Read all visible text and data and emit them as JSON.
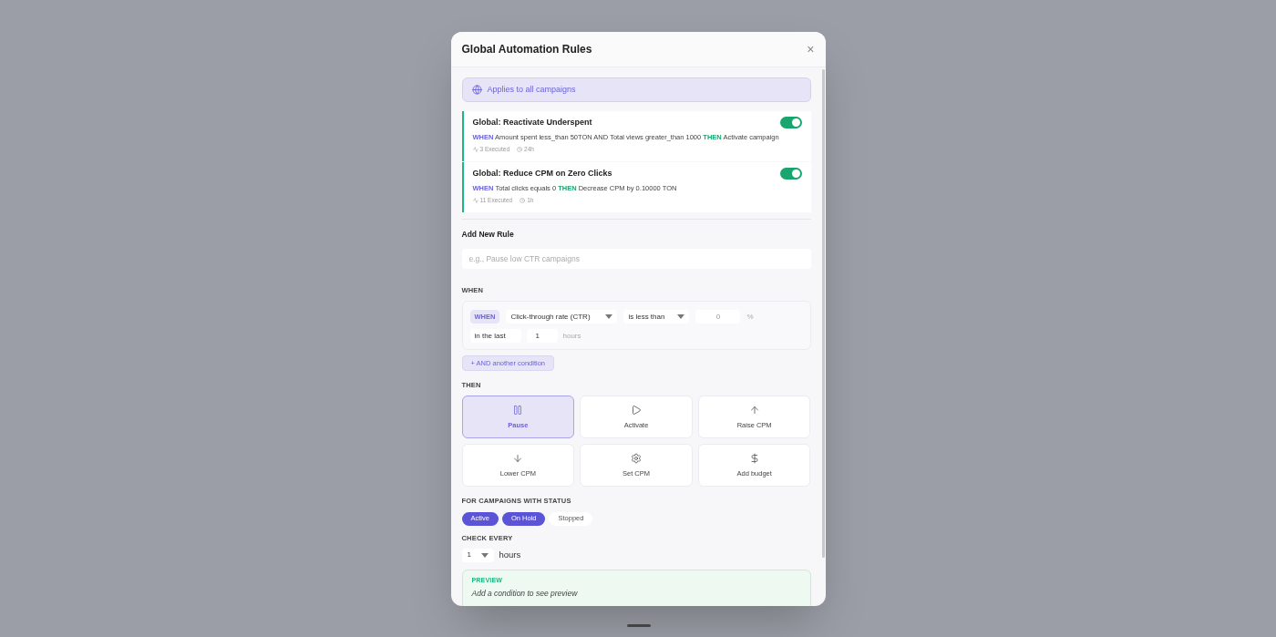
{
  "dialog": {
    "title": "Global Automation Rules",
    "close": "×"
  },
  "scope_banner": "Applies to all campaigns",
  "rules": [
    {
      "name": "Global: Reactivate Underspent",
      "on": true,
      "when_keyword": "WHEN",
      "condition": "Amount spent less_than 50TON AND Total views greater_than 1000",
      "then_keyword": "THEN",
      "action": "Activate campaign",
      "executed": "3 Executed",
      "interval": "24h"
    },
    {
      "name": "Global: Reduce CPM on Zero Clicks",
      "on": true,
      "when_keyword": "WHEN",
      "condition": "Total clicks equals 0",
      "then_keyword": "THEN",
      "action": "Decrease CPM by 0.10000 TON",
      "executed": "11 Executed",
      "interval": "1h"
    }
  ],
  "new_rule": {
    "heading": "Add New Rule",
    "name_placeholder": "e.g., Pause low CTR campaigns"
  },
  "when_section": {
    "label": "WHEN",
    "condition": {
      "badge": "WHEN",
      "metric": "Click-through rate (CTR)",
      "operator": "is less than",
      "value": "0",
      "unit": "%",
      "window_label": "in the last",
      "window_value": "1",
      "window_unit": "hours"
    },
    "add_button": "+ AND another condition"
  },
  "then_section": {
    "label": "THEN",
    "actions": [
      {
        "label": "Pause",
        "kind": "pause",
        "selected": true
      },
      {
        "label": "Activate",
        "kind": "play",
        "selected": false
      },
      {
        "label": "Raise CPM",
        "kind": "up",
        "selected": false
      },
      {
        "label": "Lower CPM",
        "kind": "down",
        "selected": false
      },
      {
        "label": "Set CPM",
        "kind": "gear",
        "selected": false
      },
      {
        "label": "Add budget",
        "kind": "dollar",
        "selected": false
      }
    ]
  },
  "status_filter": {
    "label": "FOR CAMPAIGNS WITH STATUS",
    "statuses": [
      {
        "label": "Active",
        "selected": true
      },
      {
        "label": "On Hold",
        "selected": true
      },
      {
        "label": "Stopped",
        "selected": false
      }
    ]
  },
  "check_every": {
    "label": "CHECK EVERY",
    "value": "1",
    "unit": "hours"
  },
  "preview": {
    "label": "PREVIEW",
    "text": "Add a condition to see preview"
  }
}
